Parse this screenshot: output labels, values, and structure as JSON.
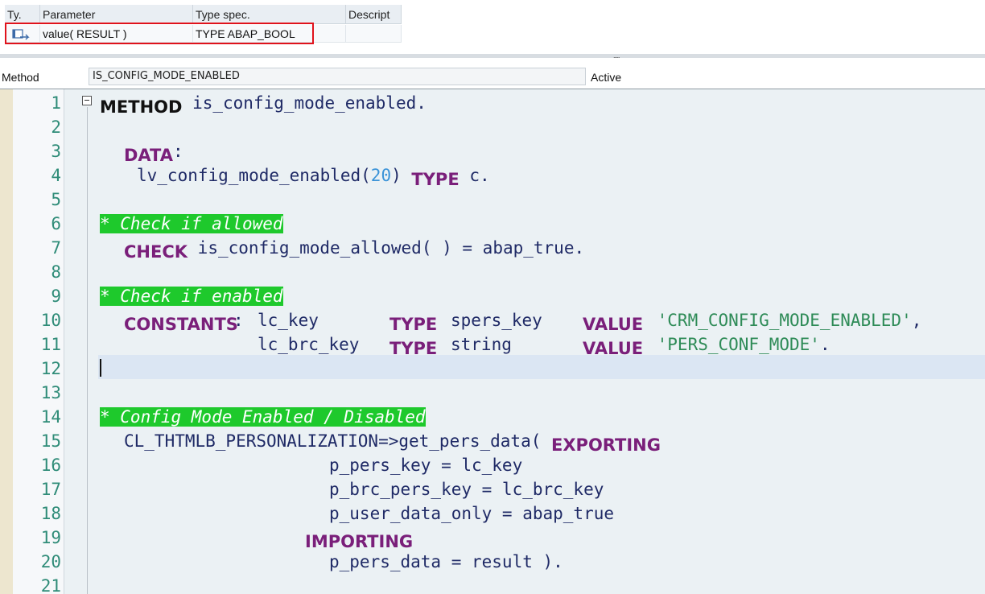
{
  "params_table": {
    "headers": [
      "Ty.",
      "Parameter",
      "Type spec.",
      "Descript"
    ],
    "row": {
      "icon": "returning-parameter-icon",
      "parameter": "value( RESULT )",
      "type_spec": "TYPE ABAP_BOOL",
      "description": ""
    },
    "highlight_color": "#e0121b"
  },
  "splitter": {
    "grip": "....."
  },
  "method_bar": {
    "label": "Method",
    "name": "IS_CONFIG_MODE_ENABLED",
    "status": "Active"
  },
  "editor": {
    "line_numbers": [
      "1",
      "2",
      "3",
      "4",
      "5",
      "6",
      "7",
      "8",
      "9",
      "10",
      "11",
      "12",
      "13",
      "14",
      "15",
      "16",
      "17",
      "18",
      "19",
      "20",
      "21"
    ],
    "current_line": 12,
    "code": {
      "l1_kw": "METHOD",
      "l1_rest": " is_config_mode_enabled.",
      "l3_kw": "DATA",
      "l3_rest": ":",
      "l4_a": "lv_config_mode_enabled(",
      "l4_num": "20",
      "l4_b": ") ",
      "l4_kw": "TYPE",
      "l4_c": " c.",
      "l6_comment": "* Check if allowed",
      "l7_kw": "CHECK",
      "l7_rest": " is_config_mode_allowed( ) = abap_true.",
      "l9_comment": "* Check if enabled",
      "l10_kw": "CONSTANTS",
      "l10_a": ": lc_key     ",
      "l10_kw2": "TYPE",
      "l10_b": " spers_key  ",
      "l10_kw3": "VALUE",
      "l10_str": " 'CRM_CONFIG_MODE_ENABLED'",
      "l10_c": ",",
      "l11_a": "lc_brc_key ",
      "l11_kw2": "TYPE",
      "l11_b": " string     ",
      "l11_kw3": "VALUE",
      "l11_str": " 'PERS_CONF_MODE'",
      "l11_c": ".",
      "l14_comment": "* Config Mode Enabled / Disabled",
      "l15_a": "CL_THTMLB_PERSONALIZATION=>get_pers_data( ",
      "l15_kw": "EXPORTING",
      "l16": "p_pers_key = lc_key",
      "l17": "p_brc_pers_key = lc_brc_key",
      "l18": "p_user_data_only = abap_true",
      "l19_kw": "IMPORTING",
      "l20": "p_pers_data = result )."
    }
  },
  "colors": {
    "keyword": "#7a1f7a",
    "identifier": "#1f2a66",
    "string": "#2e8b57",
    "number": "#3a93d8",
    "comment_bg": "#1ec92c",
    "line_number": "#2f8c78",
    "editor_bg": "#ebf1f4"
  }
}
